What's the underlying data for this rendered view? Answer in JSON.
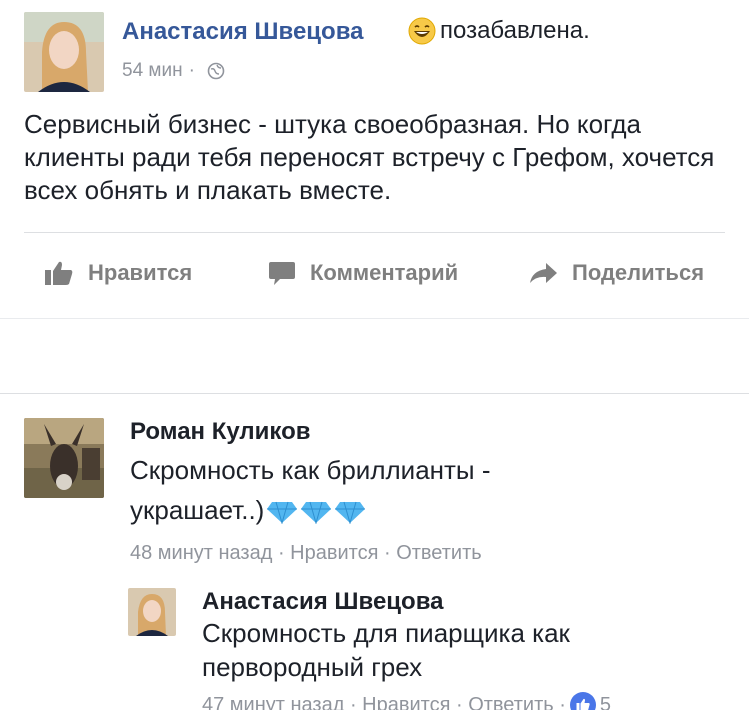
{
  "post": {
    "author": "Анастасия Швецова",
    "feeling": "позабавлена.",
    "time": "54 мин",
    "separator": "·",
    "text": "Сервисный бизнес - штука своеобразная. Но когда клиенты ради тебя переносят встречу с Грефом, хочется всех обнять и плакать вместе.",
    "actions": {
      "like": "Нравится",
      "comment": "Комментарий",
      "share": "Поделиться"
    }
  },
  "comments": [
    {
      "author": "Роман Куликов",
      "text_line1": "Скромность как бриллианты -",
      "text_line2": "украшает..)",
      "meta": "48 минут назад · Нравится · Ответить"
    }
  ],
  "reply": {
    "author": "Анастасия Швецова",
    "text_line1": "Скромность для пиарщика как",
    "text_line2": "первородный грех",
    "meta": "47 минут назад · Нравится · Ответить ·",
    "reactions": "5"
  },
  "colors": {
    "link": "#365899",
    "muted": "#90949c",
    "action_gray": "#7f7f7f",
    "like_blue": "#4a76e8"
  }
}
